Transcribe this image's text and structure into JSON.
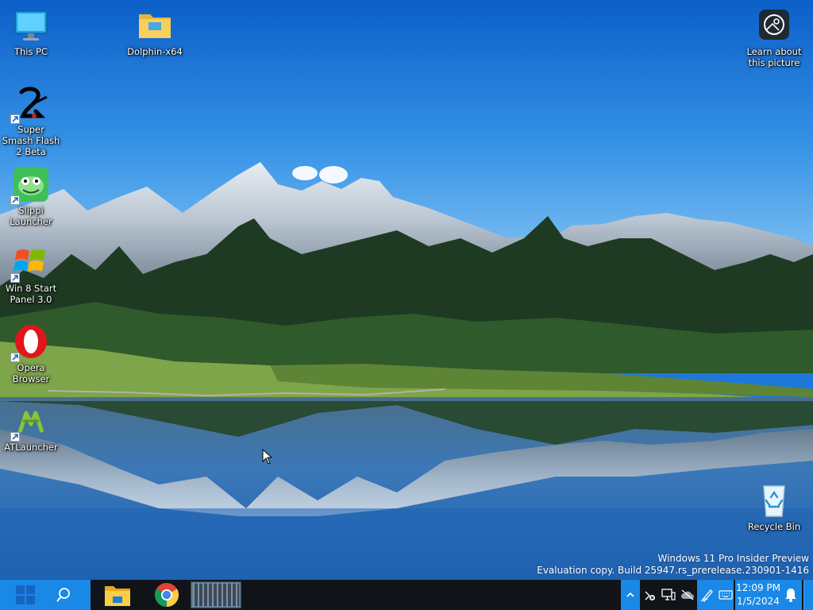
{
  "desktop": {
    "icons": [
      {
        "label": "This PC",
        "icon": "computer-icon"
      },
      {
        "label": "Dolphin-x64",
        "icon": "folder-icon"
      },
      {
        "label": "Super Smash Flash 2 Beta",
        "icon": "ssf2-icon"
      },
      {
        "label": "Slippi Launcher",
        "icon": "slippi-icon"
      },
      {
        "label": "Win 8 Start Panel 3.0",
        "icon": "windows-logo-icon"
      },
      {
        "label": "Opera Browser",
        "icon": "opera-icon"
      },
      {
        "label": "ATLauncher",
        "icon": "atlauncher-icon"
      },
      {
        "label": "Learn about this picture",
        "icon": "camera-info-icon"
      },
      {
        "label": "Recycle Bin",
        "icon": "recycle-bin-icon"
      }
    ]
  },
  "watermark": {
    "line1": "Windows 11 Pro Insider Preview",
    "line2": "Evaluation copy. Build 25947.rs_prerelease.230901-1416"
  },
  "taskbar": {
    "start_icon": "windows-start-icon",
    "search_icon": "search-icon",
    "apps": [
      {
        "name": "File Explorer",
        "icon": "file-explorer-icon"
      },
      {
        "name": "Google Chrome",
        "icon": "chrome-icon"
      },
      {
        "name": "Window thumbnail",
        "icon": "window-thumbnail-icon"
      }
    ],
    "tray": {
      "show_hidden_icon": "chevron-up-icon",
      "icons": [
        "usb-error-icon",
        "network-display-icon",
        "cloud-offline-icon",
        "pen-icon",
        "keyboard-icon"
      ]
    },
    "clock": {
      "time": "12:09 PM",
      "date": "1/5/2024"
    },
    "notifications_icon": "bell-icon"
  },
  "colors": {
    "accent": "#1a88e6",
    "taskbar": "#101418",
    "sky": "#1f78d8"
  }
}
